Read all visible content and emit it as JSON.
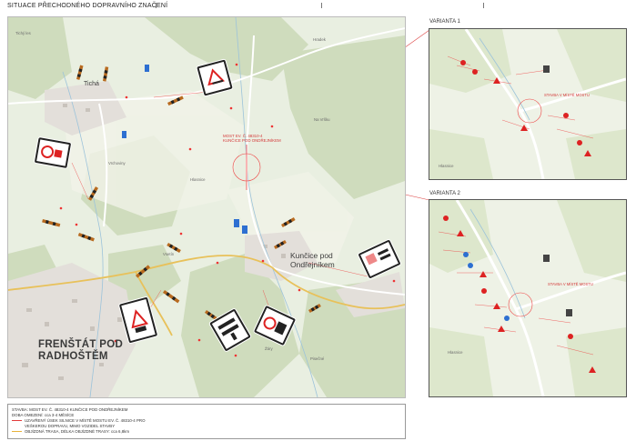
{
  "sheet": {
    "title": "SITUACE PŘECHODNÉHO DOPRAVNÍHO ZNAČENÍ"
  },
  "main_map": {
    "towns": {
      "frenstat_line1": "FRENŠTÁT POD",
      "frenstat_line2": "RADHOŠTĚM",
      "kuncice_line1": "Kunčice pod",
      "kuncice_line2": "Ondřejníkem",
      "ticha": "Tichá"
    },
    "bridge_note_line1": "MOST EV. Č. 48310-4",
    "bridge_note_line2": "KUNČICE POD ONDŘEJNÍKEM",
    "labels": {
      "tichy_les": "Tichý les",
      "vrchoviny": "Vrchoviny",
      "hlasnice": "Hlasnice",
      "na_vrsku": "Na Vršku",
      "vsetin": "Vsetín",
      "zari": "Žáry",
      "pisecne": "Pisečné",
      "hradek": "Hradek"
    }
  },
  "insets": [
    {
      "label": "VARIANTA 1",
      "note": "STAVBA V MÍSTĚ MOSTU",
      "hill": "Hlasnice"
    },
    {
      "label": "VARIANTA 2",
      "note": "STAVBA V MÍSTĚ MOSTU",
      "hill": "Hlasnice"
    }
  ],
  "legend": {
    "line1": "STAVBA: MOST EV. Č. 48310-4 KUNČICE POD ONDŘEJNÍKEM",
    "line2": "DOBA OMEZENÍ: cca 3-4 MĚSÍCE",
    "line3": "UZAVŘENÝ ÚSEK SILNICE V MÍSTĚ MOSTU EV. Č. 48310-4 PRO",
    "line4": "VEŠKEROU DOPRAVU, MIMO VOZIDEL STAVBY",
    "line5": "OBJÍZDNÁ TRASA, DÉLKA OBJÍZDNÉ TRASY: cca 6,8km",
    "closed_color": "#e23b3b",
    "detour_color": "#e8b23a"
  }
}
